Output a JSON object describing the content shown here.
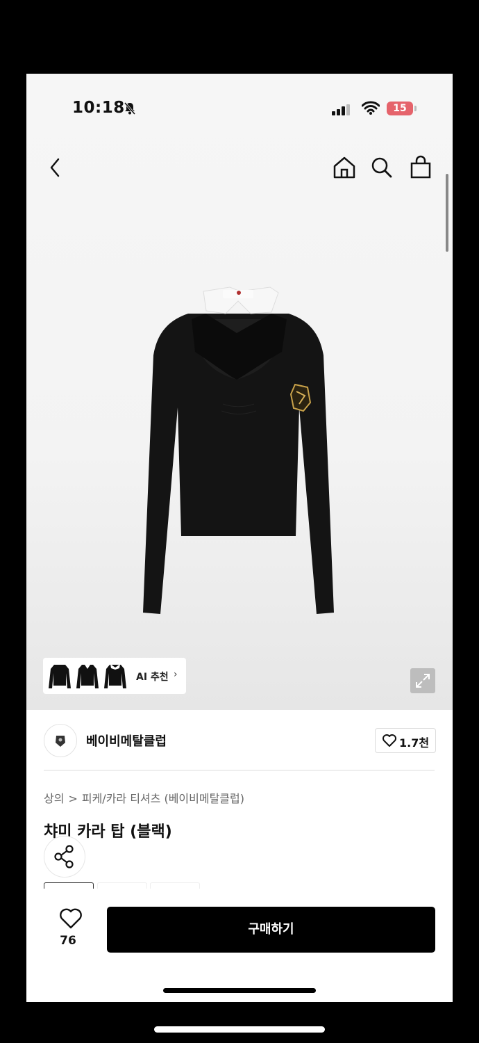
{
  "status_bar": {
    "time": "10:18",
    "battery": "15"
  },
  "nav": {
    "back": "chevron-left-icon",
    "home": "home-icon",
    "search": "search-icon",
    "cart": "shopping-bag-icon"
  },
  "recommend": {
    "label": "AI 추천",
    "arrow": "›"
  },
  "brand": {
    "name": "베이비메탈클럽",
    "likes": "1.7천"
  },
  "breadcrumb": {
    "category": "상의",
    "separator": ">",
    "subcategory": "피케/카라 티셔츠 (베이비메탈클럽)"
  },
  "product": {
    "title": "챠미 카라 탑 (블랙)"
  },
  "bottom": {
    "wish_count": "76",
    "buy_label": "구매하기"
  },
  "colors": {
    "button": "#000000",
    "battery": "#e5636b"
  }
}
